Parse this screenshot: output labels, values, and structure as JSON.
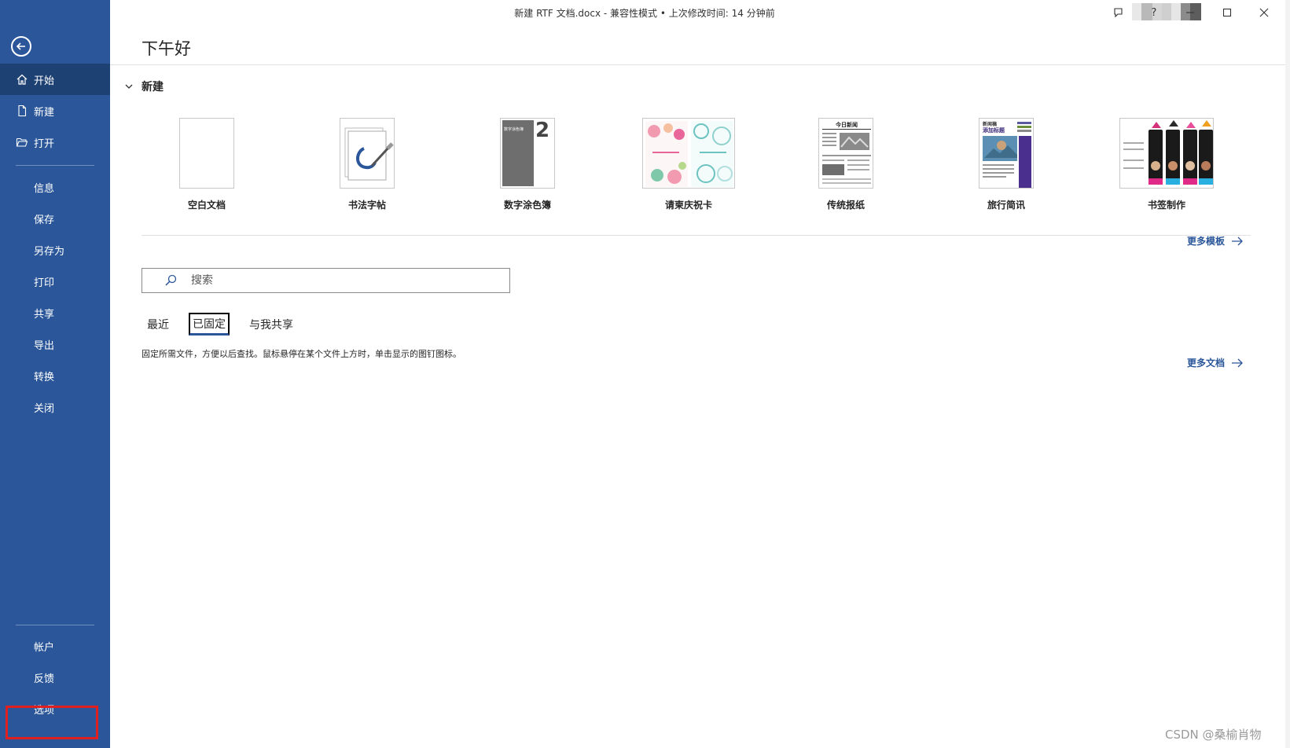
{
  "window": {
    "title": "新建 RTF 文档.docx  -  兼容性模式 • 上次修改时间: 14 分钟前",
    "help_label": "?"
  },
  "sidebar": {
    "items": [
      {
        "label": "开始",
        "icon": "home-icon"
      },
      {
        "label": "新建",
        "icon": "new-document-icon"
      },
      {
        "label": "打开",
        "icon": "open-folder-icon"
      },
      {
        "label": "信息"
      },
      {
        "label": "保存"
      },
      {
        "label": "另存为"
      },
      {
        "label": "打印"
      },
      {
        "label": "共享"
      },
      {
        "label": "导出"
      },
      {
        "label": "转换"
      },
      {
        "label": "关闭"
      }
    ],
    "bottom_items": [
      {
        "label": "帐户"
      },
      {
        "label": "反馈"
      },
      {
        "label": "选项"
      }
    ],
    "active_item": "开始",
    "highlight_color": "#e02020"
  },
  "main": {
    "greeting": "下午好",
    "new_section_label": "新建",
    "templates": [
      {
        "label": "空白文档"
      },
      {
        "label": "书法字帖"
      },
      {
        "label": "数字涂色簿",
        "thumb_text": "数字涂色簿",
        "thumb_number": "2"
      },
      {
        "label": "请柬庆祝卡"
      },
      {
        "label": "传统报纸",
        "thumb_text": "今日新闻"
      },
      {
        "label": "旅行简讯",
        "thumb_text_1": "新闻稿",
        "thumb_text_2": "添加标题"
      },
      {
        "label": "书签制作"
      }
    ],
    "more_templates": "更多模板",
    "search_placeholder": "搜索",
    "tabs": [
      {
        "label": "最近"
      },
      {
        "label": "已固定"
      },
      {
        "label": "与我共享"
      }
    ],
    "active_tab": "已固定",
    "pinned_hint": "固定所需文件，方便以后查找。鼠标悬停在某个文件上方时，单击显示的图钉图标。",
    "more_documents": "更多文档"
  },
  "watermark": "CSDN @桑榆肖物",
  "colors": {
    "sidebar_bg": "#2b579a",
    "sidebar_active": "#1e4173",
    "accent": "#2b579a"
  }
}
